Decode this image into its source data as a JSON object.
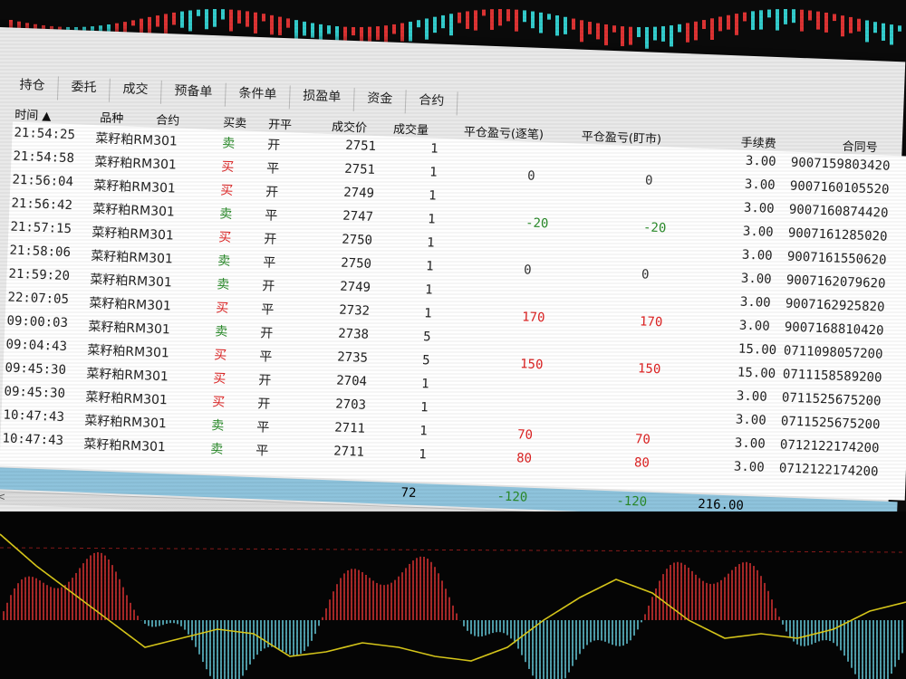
{
  "tabs": [
    "持仓",
    "委托",
    "成交",
    "预备单",
    "条件单",
    "损盈单",
    "资金",
    "合约"
  ],
  "columns": {
    "time": "时间 ▲",
    "variety": "品种",
    "contract": "合约",
    "side": "买卖",
    "open_close": "开平",
    "price": "成交价",
    "qty": "成交量",
    "pnl_trade": "平仓盈亏(逐笔)",
    "pnl_mark": "平仓盈亏(盯市)",
    "fee": "手续费",
    "contract_no": "合同号"
  },
  "rows": [
    {
      "time": "21:54:25",
      "name": "菜籽粕RM301",
      "side": "卖",
      "oc": "开",
      "price": "2751",
      "qty": "1",
      "pnl1": "",
      "pnl2": "",
      "fee": "3.00",
      "no": "9007159803420"
    },
    {
      "time": "21:54:58",
      "name": "菜籽粕RM301",
      "side": "买",
      "oc": "平",
      "price": "2751",
      "qty": "1",
      "pnl1": "0",
      "pnl2": "0",
      "fee": "3.00",
      "no": "9007160105520"
    },
    {
      "time": "21:56:04",
      "name": "菜籽粕RM301",
      "side": "买",
      "oc": "开",
      "price": "2749",
      "qty": "1",
      "pnl1": "",
      "pnl2": "",
      "fee": "3.00",
      "no": "9007160874420"
    },
    {
      "time": "21:56:42",
      "name": "菜籽粕RM301",
      "side": "卖",
      "oc": "平",
      "price": "2747",
      "qty": "1",
      "pnl1": "-20",
      "pnl2": "-20",
      "fee": "3.00",
      "no": "9007161285020"
    },
    {
      "time": "21:57:15",
      "name": "菜籽粕RM301",
      "side": "买",
      "oc": "开",
      "price": "2750",
      "qty": "1",
      "pnl1": "",
      "pnl2": "",
      "fee": "3.00",
      "no": "9007161550620"
    },
    {
      "time": "21:58:06",
      "name": "菜籽粕RM301",
      "side": "卖",
      "oc": "平",
      "price": "2750",
      "qty": "1",
      "pnl1": "0",
      "pnl2": "0",
      "fee": "3.00",
      "no": "9007162079620"
    },
    {
      "time": "21:59:20",
      "name": "菜籽粕RM301",
      "side": "卖",
      "oc": "开",
      "price": "2749",
      "qty": "1",
      "pnl1": "",
      "pnl2": "",
      "fee": "3.00",
      "no": "9007162925820"
    },
    {
      "time": "22:07:05",
      "name": "菜籽粕RM301",
      "side": "买",
      "oc": "平",
      "price": "2732",
      "qty": "1",
      "pnl1": "170",
      "pnl2": "170",
      "fee": "3.00",
      "no": "9007168810420"
    },
    {
      "time": "09:00:03",
      "name": "菜籽粕RM301",
      "side": "卖",
      "oc": "开",
      "price": "2738",
      "qty": "5",
      "pnl1": "",
      "pnl2": "",
      "fee": "15.00",
      "no": "0711098057200"
    },
    {
      "time": "09:04:43",
      "name": "菜籽粕RM301",
      "side": "买",
      "oc": "平",
      "price": "2735",
      "qty": "5",
      "pnl1": "150",
      "pnl2": "150",
      "fee": "15.00",
      "no": "0711158589200"
    },
    {
      "time": "09:45:30",
      "name": "菜籽粕RM301",
      "side": "买",
      "oc": "开",
      "price": "2704",
      "qty": "1",
      "pnl1": "",
      "pnl2": "",
      "fee": "3.00",
      "no": "0711525675200"
    },
    {
      "time": "09:45:30",
      "name": "菜籽粕RM301",
      "side": "买",
      "oc": "开",
      "price": "2703",
      "qty": "1",
      "pnl1": "",
      "pnl2": "",
      "fee": "3.00",
      "no": "0711525675200"
    },
    {
      "time": "10:47:43",
      "name": "菜籽粕RM301",
      "side": "卖",
      "oc": "平",
      "price": "2711",
      "qty": "1",
      "pnl1": "70",
      "pnl2": "70",
      "fee": "3.00",
      "no": "0712122174200"
    },
    {
      "time": "10:47:43",
      "name": "菜籽粕RM301",
      "side": "卖",
      "oc": "平",
      "price": "2711",
      "qty": "1",
      "pnl1": "80",
      "pnl2": "80",
      "fee": "3.00",
      "no": "0712122174200"
    }
  ],
  "totals": {
    "qty": "72",
    "pnl1": "-120",
    "pnl2": "-120",
    "fee": "216.00"
  },
  "colors": {
    "buy": "#d22222",
    "sell": "#2a8a2a",
    "total_row": "#8ec3dc"
  }
}
